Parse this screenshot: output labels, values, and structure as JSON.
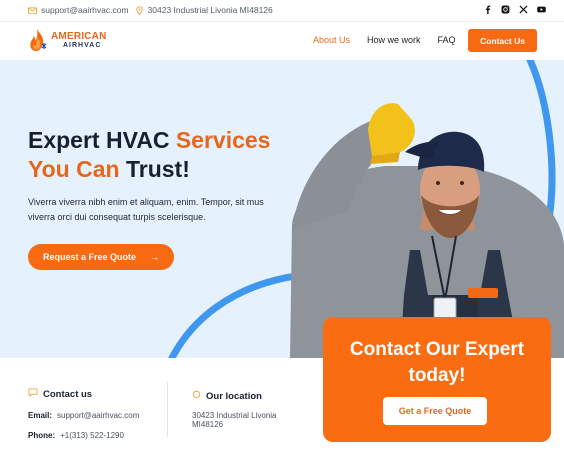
{
  "topbar": {
    "email": "support@aairhvac.com",
    "address": "30423 Industrial Livonia MI48126",
    "social": [
      "facebook-icon",
      "instagram-icon",
      "x-icon",
      "youtube-icon"
    ]
  },
  "brand": {
    "line1": "AMERICAN",
    "line2": "AIRHVAC"
  },
  "nav": {
    "items": [
      {
        "label": "About Us",
        "active": true
      },
      {
        "label": "How we work",
        "active": false
      },
      {
        "label": "FAQ",
        "active": false
      }
    ],
    "contact_button": "Contact Us"
  },
  "hero": {
    "title_a": "Expert HVAC ",
    "title_b": "Services",
    "title_c": "You Can",
    "title_d": " Trust!",
    "lead": "Viverra viverra nibh enim et aliquam, enim. Tempor, sit mus viverra orci dui consequat turpis scelerisque.",
    "cta": "Request a Free Quote",
    "cta_arrow": "→"
  },
  "contact_us": {
    "heading": "Contact us",
    "email_label": "Email:",
    "email": "support@aairhvac.com",
    "phone_label": "Phone:",
    "phone": "+1(313) 522-1290"
  },
  "location": {
    "heading": "Our location",
    "address": "30423 Industrial Livonia MI48126"
  },
  "expert_card": {
    "title": "Contact Our Expert today!",
    "button": "Get a Free Quote"
  },
  "colors": {
    "accent": "#f86a12",
    "hero_bg": "#e6f1fe",
    "navy": "#172033",
    "arc_blue": "#3f97ee"
  }
}
